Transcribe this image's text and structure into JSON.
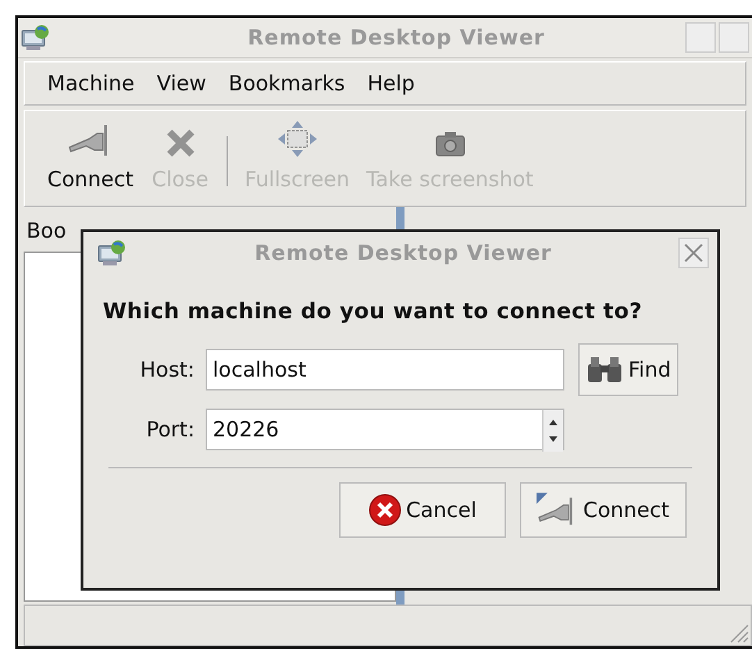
{
  "window": {
    "title": "Remote Desktop Viewer"
  },
  "menu": [
    "Machine",
    "View",
    "Bookmarks",
    "Help"
  ],
  "toolbar": [
    {
      "kind": "connect",
      "label": "Connect",
      "disabled": false
    },
    {
      "kind": "close",
      "label": "Close",
      "disabled": true
    },
    {
      "kind": "separator"
    },
    {
      "kind": "fullscreen",
      "label": "Fullscreen",
      "disabled": true
    },
    {
      "kind": "screenshot",
      "label": "Take screenshot",
      "disabled": true
    }
  ],
  "bookmarks_pane": {
    "header": "Boo"
  },
  "dialog": {
    "title": "Remote Desktop Viewer",
    "question": "Which machine do you want to connect to?",
    "host": {
      "label": "Host:",
      "value": "localhost",
      "button": "Find"
    },
    "port": {
      "label": "Port:",
      "value": "20226"
    },
    "buttons": [
      {
        "kind": "cancel",
        "label": "Cancel"
      },
      {
        "kind": "connect",
        "label": "Connect"
      }
    ]
  }
}
